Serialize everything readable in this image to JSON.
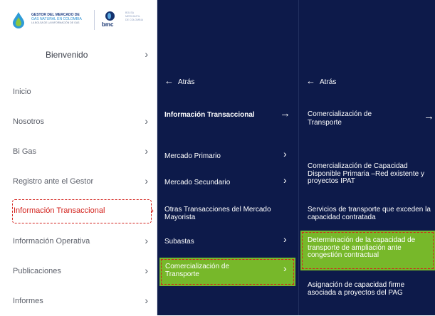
{
  "logo": {
    "line1": "GESTOR DEL MERCADO DE",
    "line2": "GAS NATURAL EN COLOMBIA",
    "line3": "LA BOLSA DE LA INFORMACIÓN DE GAS",
    "bmc": "bmc",
    "right_text": [
      "BOLSA",
      "MERCANTIL",
      "DE COLOMBIA"
    ]
  },
  "sidebar": {
    "welcome": "Bienvenido",
    "items": [
      {
        "label": "Inicio",
        "has_chevron": false
      },
      {
        "label": "Nosotros",
        "has_chevron": true
      },
      {
        "label": "Bi Gas",
        "has_chevron": true
      },
      {
        "label": "Registro ante el Gestor",
        "has_chevron": true
      },
      {
        "label": "Información Transaccional",
        "has_chevron": true,
        "highlighted": true
      },
      {
        "label": "Información Operativa",
        "has_chevron": true
      },
      {
        "label": "Publicaciones",
        "has_chevron": true
      },
      {
        "label": "Informes",
        "has_chevron": true
      }
    ]
  },
  "submenu1": {
    "back": "Atrás",
    "header": "Información Transaccional",
    "items": [
      {
        "label": "Mercado Primario"
      },
      {
        "label": "Mercado Secundario"
      },
      {
        "label": "Otras Transacciones del Mercado Mayorista"
      },
      {
        "label": "Subastas"
      },
      {
        "label": "Comercialización de Transporte",
        "highlighted": true
      }
    ]
  },
  "submenu2": {
    "back": "Atrás",
    "header": "Comercialización de Transporte",
    "items": [
      {
        "label": "Comercialización de Capacidad Disponible Primaria –Red existente y proyectos IPAT"
      },
      {
        "label": "Servicios de transporte que exceden la capacidad contratada"
      },
      {
        "label": "Determinación de la capacidad de transporte de ampliación ante congestión contractual",
        "highlighted": true
      },
      {
        "label": "Asignación de capacidad firme asociada a proyectos del PAG"
      }
    ]
  },
  "icons": {
    "back": "arrow-left-icon",
    "forward": "arrow-right-icon",
    "chevron": "chevron-right-icon"
  },
  "colors": {
    "nav_bg": "#0d1a4a",
    "highlight_green": "#77b82a",
    "dash_red": "#d3221c"
  }
}
